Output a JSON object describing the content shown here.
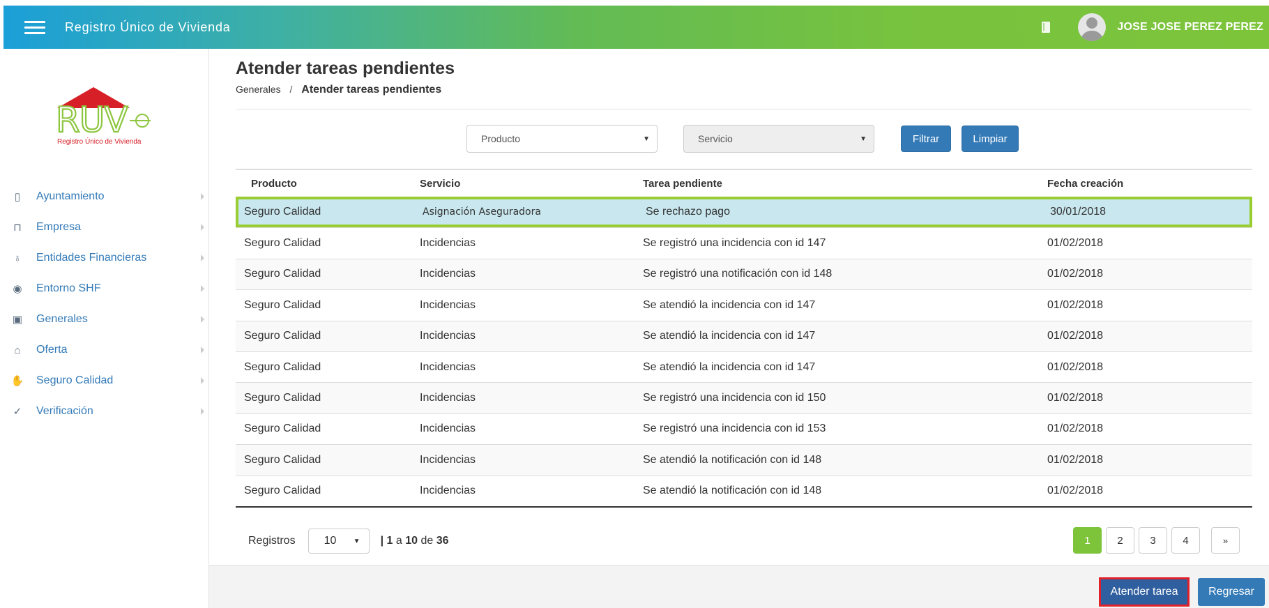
{
  "header": {
    "app_title": "Registro Único de Vivienda",
    "user_name": "JOSE JOSE PEREZ PEREZ"
  },
  "logo": {
    "text": "RUV",
    "subtitle": "Registro Único de Vivienda"
  },
  "sidebar": {
    "items": [
      {
        "label": "Ayuntamiento",
        "icon": "map-icon"
      },
      {
        "label": "Empresa",
        "icon": "building-icon"
      },
      {
        "label": "Entidades Financieras",
        "icon": "money-bags-icon"
      },
      {
        "label": "Entorno SHF",
        "icon": "target-icon"
      },
      {
        "label": "Generales",
        "icon": "id-card-icon"
      },
      {
        "label": "Oferta",
        "icon": "house-hand-icon"
      },
      {
        "label": "Seguro Calidad",
        "icon": "handshake-icon"
      },
      {
        "label": "Verificación",
        "icon": "check-circle-icon"
      }
    ]
  },
  "page": {
    "title": "Atender tareas pendientes",
    "breadcrumb": [
      "Generales",
      "Atender tareas pendientes"
    ]
  },
  "filters": {
    "producto_placeholder": "Producto",
    "servicio_placeholder": "Servicio",
    "filter_label": "Filtrar",
    "clear_label": "Limpiar"
  },
  "table": {
    "columns": [
      "Producto",
      "Servicio",
      "Tarea pendiente",
      "Fecha creación"
    ],
    "rows": [
      [
        "Seguro Calidad",
        "Asignación Aseguradora",
        "Se rechazo pago",
        "30/01/2018"
      ],
      [
        "Seguro Calidad",
        "Incidencias",
        "Se registró una incidencia con id 147",
        "01/02/2018"
      ],
      [
        "Seguro Calidad",
        "Incidencias",
        "Se registró una notificación con id 148",
        "01/02/2018"
      ],
      [
        "Seguro Calidad",
        "Incidencias",
        "Se atendió la incidencia con id 147",
        "01/02/2018"
      ],
      [
        "Seguro Calidad",
        "Incidencias",
        "Se atendió la incidencia con id 147",
        "01/02/2018"
      ],
      [
        "Seguro Calidad",
        "Incidencias",
        "Se atendió la incidencia con id 147",
        "01/02/2018"
      ],
      [
        "Seguro Calidad",
        "Incidencias",
        "Se registró una incidencia con id 150",
        "01/02/2018"
      ],
      [
        "Seguro Calidad",
        "Incidencias",
        "Se registró una incidencia con id 153",
        "01/02/2018"
      ],
      [
        "Seguro Calidad",
        "Incidencias",
        "Se atendió la notificación con id 148",
        "01/02/2018"
      ],
      [
        "Seguro Calidad",
        "Incidencias",
        "Se atendió la notificación con id 148",
        "01/02/2018"
      ]
    ],
    "selected_row": 0
  },
  "pager": {
    "records_label": "Registros",
    "page_size": "10",
    "range_sep": "|",
    "range_from": "1",
    "range_a": "a",
    "range_to": "10",
    "range_de": "de",
    "total": "36",
    "pages": [
      "1",
      "2",
      "3",
      "4"
    ],
    "active_page": "1",
    "next_label": "»"
  },
  "actions": {
    "attend_label": "Atender tarea",
    "back_label": "Regresar"
  },
  "colors": {
    "accent_green": "#7dc43a",
    "primary_blue": "#337ab7",
    "selection_border": "#9acd32",
    "highlight_red": "#e0202a"
  }
}
